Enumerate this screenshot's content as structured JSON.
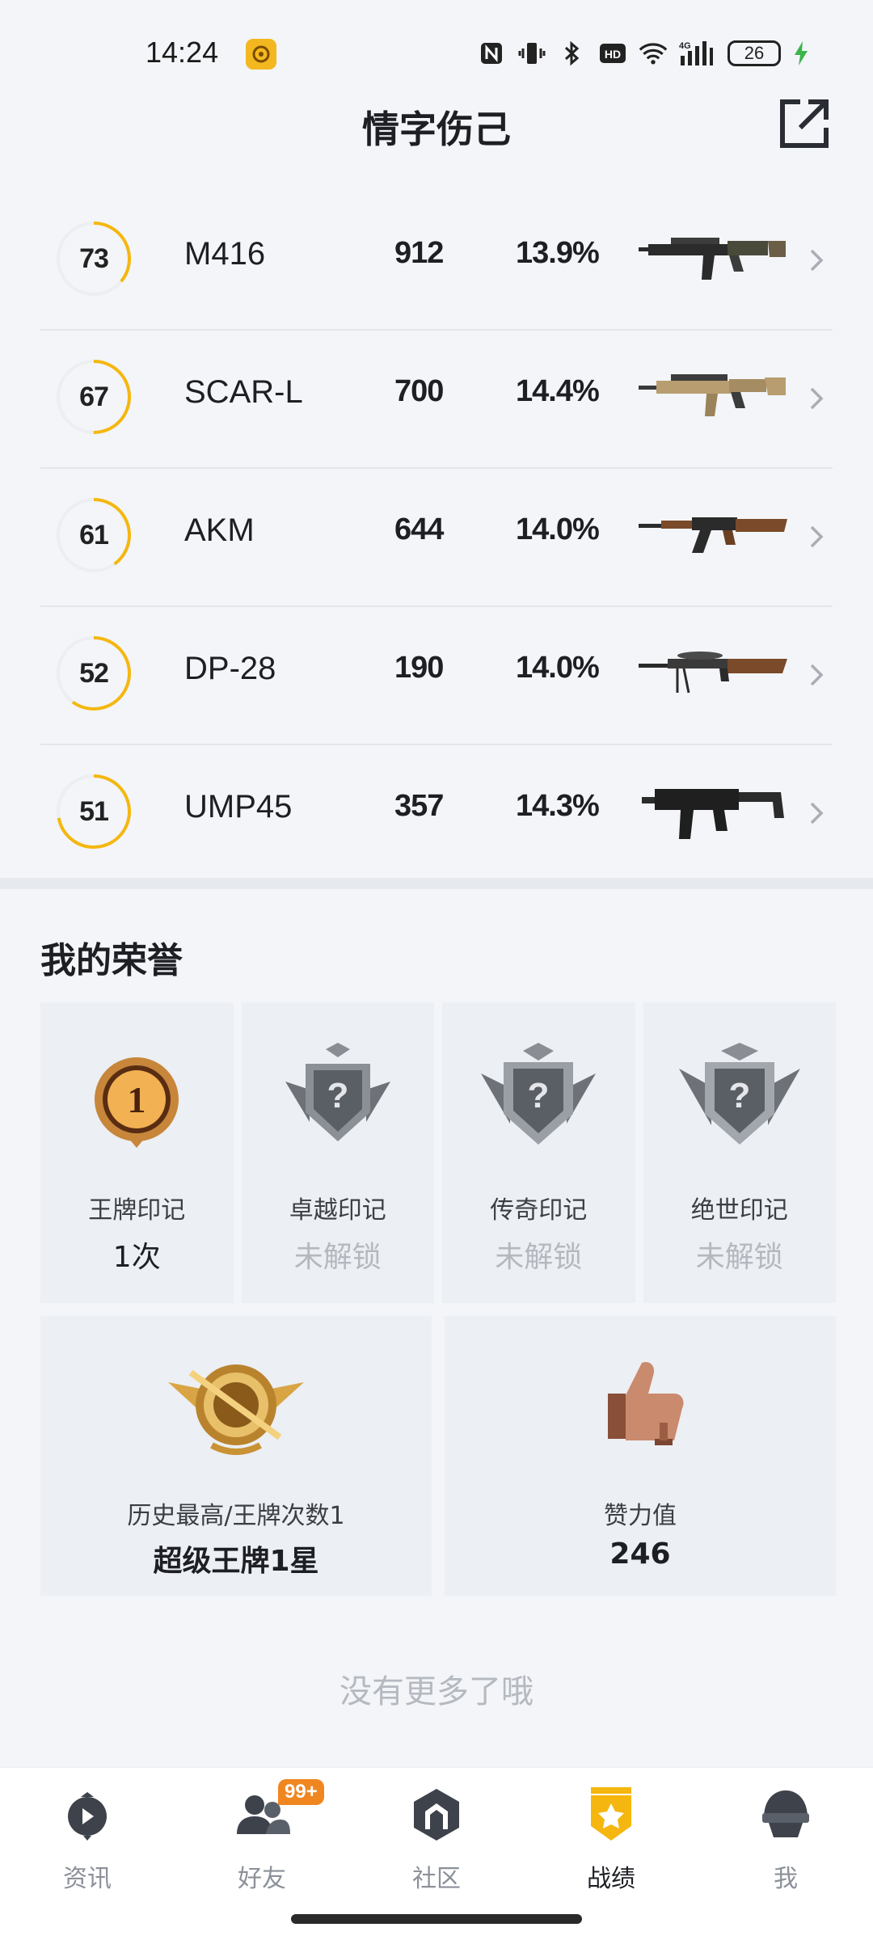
{
  "status_bar": {
    "time": "14:24",
    "network": "4G",
    "battery": "26",
    "icons": [
      "nfc-icon",
      "vibrate-icon",
      "bluetooth-icon",
      "hd-icon",
      "wifi-icon",
      "signal-icon",
      "battery-icon",
      "charging-icon"
    ]
  },
  "header": {
    "title": "情字伤己",
    "share_icon": "share-external-icon"
  },
  "weapons": [
    {
      "level": "73",
      "level_fraction": 0.36,
      "name": "M416",
      "count": "912",
      "rate": "13.9%",
      "image": "rifle-m416"
    },
    {
      "level": "67",
      "level_fraction": 0.5,
      "name": "SCAR-L",
      "count": "700",
      "rate": "14.4%",
      "image": "rifle-scar"
    },
    {
      "level": "61",
      "level_fraction": 0.4,
      "name": "AKM",
      "count": "644",
      "rate": "14.0%",
      "image": "rifle-akm"
    },
    {
      "level": "52",
      "level_fraction": 0.6,
      "name": "DP-28",
      "count": "190",
      "rate": "14.0%",
      "image": "lmg-dp28"
    },
    {
      "level": "51",
      "level_fraction": 0.72,
      "name": "UMP45",
      "count": "357",
      "rate": "14.3%",
      "image": "smg-ump45"
    }
  ],
  "honors": {
    "title": "我的荣誉",
    "marks": [
      {
        "name": "王牌印记",
        "value": "1次",
        "locked": false,
        "icon": "ace-mark-icon"
      },
      {
        "name": "卓越印记",
        "value": "未解锁",
        "locked": true,
        "icon": "locked-mark-icon"
      },
      {
        "name": "传奇印记",
        "value": "未解锁",
        "locked": true,
        "icon": "locked-mark-icon"
      },
      {
        "name": "绝世印记",
        "value": "未解锁",
        "locked": true,
        "icon": "locked-mark-icon"
      }
    ],
    "stats": [
      {
        "name": "历史最高/王牌次数1",
        "value": "超级王牌1星",
        "icon": "super-ace-badge-icon"
      },
      {
        "name": "赞力值",
        "value": "246",
        "icon": "thumbs-up-icon"
      }
    ]
  },
  "footer": {
    "no_more": "没有更多了哦"
  },
  "bottom_nav": {
    "items": [
      {
        "label": "资讯",
        "icon": "news-icon",
        "active": false
      },
      {
        "label": "好友",
        "icon": "friends-icon",
        "active": false,
        "badge": "99+"
      },
      {
        "label": "社区",
        "icon": "community-icon",
        "active": false
      },
      {
        "label": "战绩",
        "icon": "record-icon",
        "active": true
      },
      {
        "label": "我",
        "icon": "profile-icon",
        "active": false
      }
    ]
  },
  "colors": {
    "accent": "#f5b70f",
    "badge": "#f0861f",
    "locked_text": "#b4b8bf",
    "background": "#f3f5f8"
  }
}
